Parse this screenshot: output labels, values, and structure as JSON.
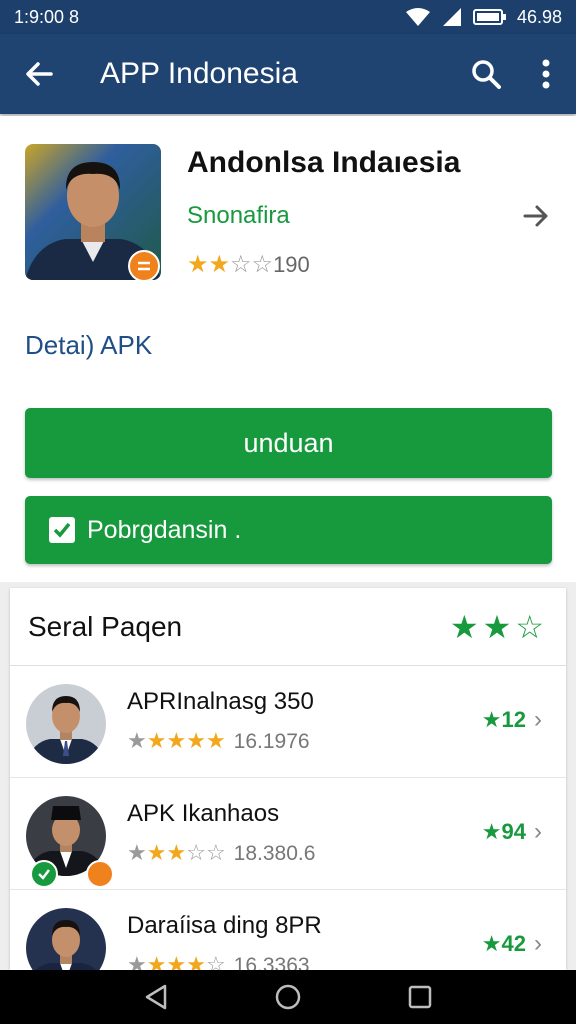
{
  "status_bar": {
    "time": "1:9:00 8",
    "battery_text": "46.98"
  },
  "app_bar": {
    "title": "APP Indonesia"
  },
  "app": {
    "name": "Andonlsa Indaıesia",
    "developer": "Snonafira",
    "rating_value": 2,
    "rating_max": 4,
    "rating_count": "190",
    "detail_link": "Detai) APK"
  },
  "buttons": {
    "download": "unduan",
    "check": "Pobrgdansin ."
  },
  "list": {
    "title": "Seral Paqen",
    "header_stars": [
      "full",
      "full",
      "outline"
    ],
    "items": [
      {
        "name": "APRInalnasg 350",
        "stars_full": 4,
        "stars_total": 5,
        "meta": "16.1976",
        "score": "★12"
      },
      {
        "name": "APK Ikanhaos",
        "stars_full": 2,
        "stars_total": 5,
        "meta": "18.380.6",
        "score": "★94"
      },
      {
        "name": "Daraíisa ding 8PR",
        "stars_full": 3,
        "stars_total": 5,
        "meta": "16.3363",
        "score": "★42"
      }
    ]
  },
  "colors": {
    "app_bar": "#1f4472",
    "green": "#17993d",
    "star": "#f2a81c",
    "link": "#1f4f86",
    "badge_orange": "#f0821e"
  },
  "icons": [
    "back-arrow-icon",
    "search-icon",
    "more-vert-icon",
    "chevron-right-icon",
    "check-icon",
    "nav-back-icon",
    "nav-home-icon",
    "nav-recents-icon"
  ]
}
